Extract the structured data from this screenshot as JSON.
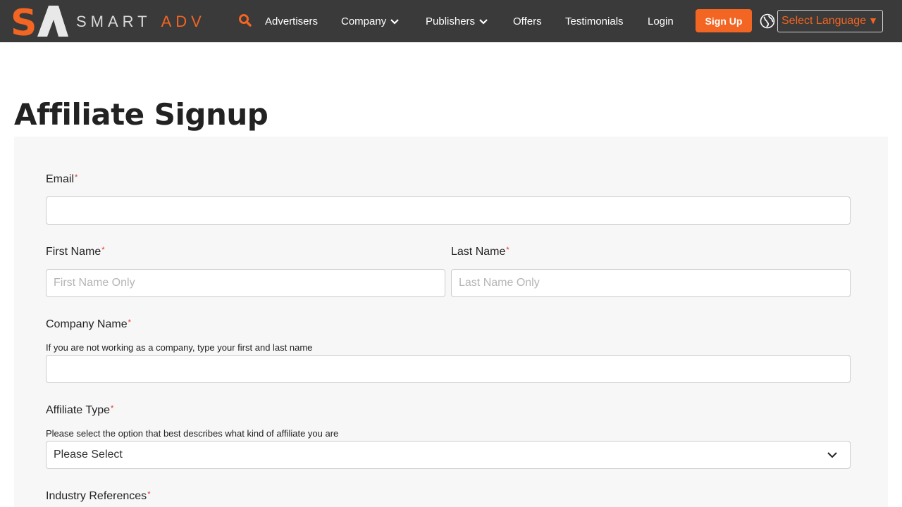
{
  "brand": {
    "logo_letters": "SA",
    "name_part1": "SMART",
    "name_part2": "ADV",
    "accent_color": "#f26522"
  },
  "nav": {
    "items": [
      {
        "label": "Advertisers",
        "dropdown": false
      },
      {
        "label": "Company",
        "dropdown": true
      },
      {
        "label": "Publishers",
        "dropdown": true
      },
      {
        "label": "Offers",
        "dropdown": false
      },
      {
        "label": "Testimonials",
        "dropdown": false
      },
      {
        "label": "Login",
        "dropdown": false
      }
    ],
    "signup_label": "Sign Up",
    "language_label": "Select Language",
    "language_arrow": "▼",
    "icons": {
      "search": "search-icon",
      "globe": "globe-icon"
    }
  },
  "page": {
    "title": "Affiliate Signup"
  },
  "form": {
    "required_marker": "*",
    "email": {
      "label": "Email",
      "value": ""
    },
    "first_name": {
      "label": "First Name",
      "placeholder": "First Name Only",
      "value": ""
    },
    "last_name": {
      "label": "Last Name",
      "placeholder": "Last Name Only",
      "value": ""
    },
    "company_name": {
      "label": "Company Name",
      "hint": "If you are not working as a company, type your first and last name",
      "value": ""
    },
    "affiliate_type": {
      "label": "Affiliate Type",
      "hint": "Please select the option that best describes what kind of affiliate you are",
      "selected": "Please Select"
    },
    "industry_references": {
      "label": "Industry References"
    }
  }
}
